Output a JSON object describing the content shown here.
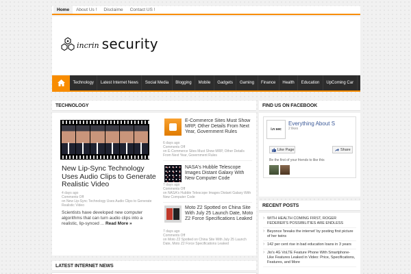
{
  "topnav": {
    "items": [
      "Home",
      "About Us !",
      "Disclaime",
      "Contact US !"
    ]
  },
  "brand": {
    "small": "incrin",
    "big": "security"
  },
  "mainnav": {
    "items": [
      "Technology",
      "Latest Internet News",
      "Social Media",
      "Blogging",
      "Mobile",
      "Gadgets",
      "Gaming",
      "Finance",
      "Health",
      "Education",
      "UpComing Car"
    ]
  },
  "technology": {
    "section_title": "TECHNOLOGY",
    "featured": {
      "title": "New Lip-Sync Technology Uses Audio Clips to Generate Realistic Video",
      "meta": [
        "4 days ago",
        "Comments Off",
        "on New Lip-Sync Technology Uses Audio Clips to Generate Realistic Video"
      ],
      "excerpt": "Scientists have developed new computer algorithms that can turn audio clips into a realistic, lip-synced ...",
      "read_more": "Read More »"
    },
    "items": [
      {
        "title": "E-Commerce Sites Must Show MRP, Other Details From Next Year, Government Rules",
        "meta": [
          "6 days ago",
          "Comments Off",
          "on E-Commerce Sites Must Show MRP, Other Details From Next Year, Government Rules"
        ]
      },
      {
        "title": "NASA's Hubble Telescope Images Distant Galaxy With New Computer Code",
        "meta": [
          "7 days ago",
          "Comments Off",
          "on NASA's Hubble Telescope Images Distant Galaxy With New Computer Code"
        ]
      },
      {
        "title": "Moto Z2 Spotted on China Site With July 25 Launch Date, Moto Z2 Force Specifications Leaked",
        "meta": [
          "7 days ago",
          "Comments Off",
          "on Moto Z2 Spotted on China Site With July 25 Launch Date, Moto Z2 Force Specifications Leaked"
        ]
      }
    ]
  },
  "facebook": {
    "section_title": "FIND US ON FACEBOOK",
    "page_name": "Everything About S",
    "logo_text": "i.n sec",
    "likes": "2 likes",
    "like_label": "Like Page",
    "share_label": "Share",
    "friends_text": "Be the first of your friends to like this"
  },
  "recent": {
    "section_title": "RECENT POSTS",
    "items": [
      "WITH HEALTH COMING FIRST, ROGER FEDERER'S POSSIBILITIES ARE ENDLESS",
      "Beyonce 'breaks the internet' by posting first picture of her twins",
      "142 per cent rise in bad education loans in 3 years",
      "Jio's 4G VoLTE Feature Phone With Smartphone-Like Features Leaked in Video: Price, Specifications, Features, and More"
    ]
  },
  "latest": {
    "section_title": "LATEST INTERNET NEWS"
  },
  "colors": {
    "accent": "#f88c00",
    "nav_bg": "#2d2d2d",
    "fb_blue": "#3b5998"
  }
}
